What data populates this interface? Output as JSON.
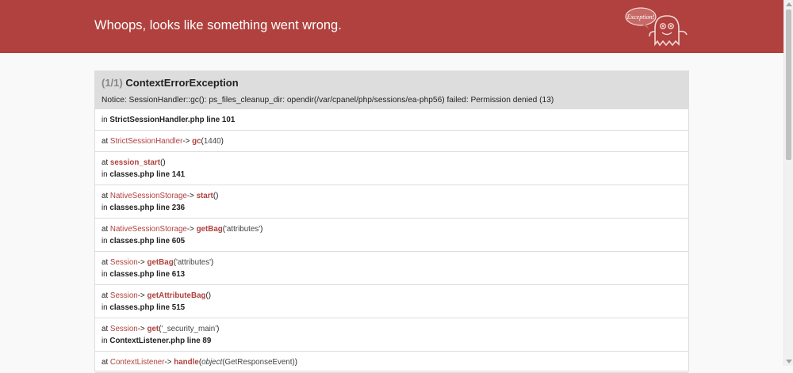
{
  "header": {
    "title": "Whoops, looks like something went wrong.",
    "mascot_label": "Exception!"
  },
  "exception": {
    "count": "(1/1)",
    "name": "ContextErrorException",
    "message": "Notice: SessionHandler::gc(): ps_files_cleanup_dir: opendir(/var/cpanel/php/sessions/ea-php56) failed: Permission denied (13)"
  },
  "trace": {
    "t0": {
      "in": "in",
      "file": "StrictSessionHandler.php line 101"
    },
    "t1": {
      "at": "at",
      "cls": "StrictSessionHandler",
      "arrow": "->",
      "fn": "gc",
      "open": "(",
      "arg": "1440",
      "close": ")"
    },
    "t2": {
      "at": "at",
      "fn": "session_start",
      "parens": "()",
      "in": "in",
      "file": "classes.php line 141"
    },
    "t3": {
      "at": "at",
      "cls": "NativeSessionStorage",
      "arrow": "->",
      "fn": "start",
      "parens": "()",
      "in": "in",
      "file": "classes.php line 236"
    },
    "t4": {
      "at": "at",
      "cls": "NativeSessionStorage",
      "arrow": "->",
      "fn": "getBag",
      "open": "(",
      "arg": "'attributes'",
      "close": ")",
      "in": "in",
      "file": "classes.php line 605"
    },
    "t5": {
      "at": "at",
      "cls": "Session",
      "arrow": "->",
      "fn": "getBag",
      "open": "(",
      "arg": "'attributes'",
      "close": ")",
      "in": "in",
      "file": "classes.php line 613"
    },
    "t6": {
      "at": "at",
      "cls": "Session",
      "arrow": "->",
      "fn": "getAttributeBag",
      "parens": "()",
      "in": "in",
      "file": "classes.php line 515"
    },
    "t7": {
      "at": "at",
      "cls": "Session",
      "arrow": "->",
      "fn": "get",
      "open": "(",
      "arg": "'_security_main'",
      "close": ")",
      "in": "in",
      "file": "ContextListener.php line 89"
    },
    "t8": {
      "at": "at",
      "cls": "ContextListener",
      "arrow": "->",
      "fn": "handle",
      "open": "(",
      "arg_type": "object",
      "arg": "(GetResponseEvent)",
      "close": ")"
    }
  },
  "colors": {
    "header_bg": "#b0413e",
    "accent": "#b0413e",
    "panel_header_bg": "#dddddd"
  }
}
